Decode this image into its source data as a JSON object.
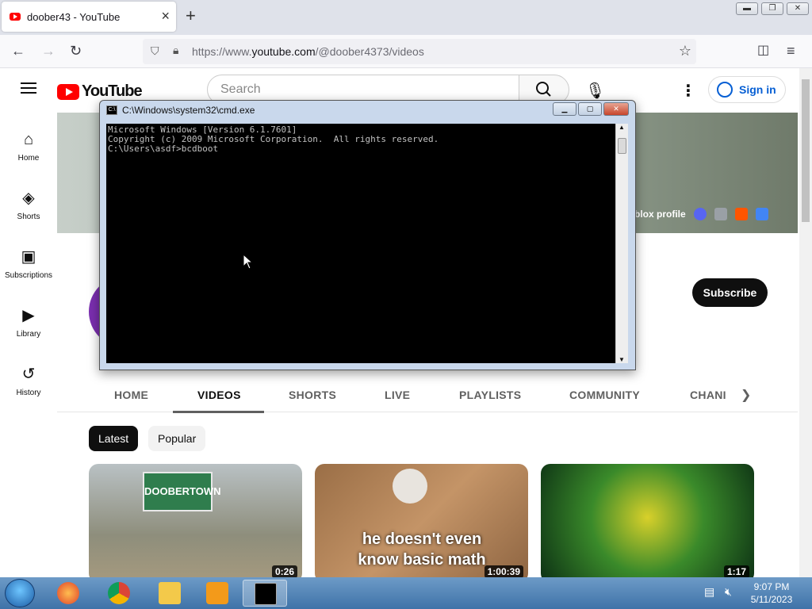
{
  "browser": {
    "tab_title": "doober43 - YouTube",
    "url_prefix": "https://www.",
    "url_domain": "youtube.com",
    "url_path": "/@doober4373/videos"
  },
  "youtube": {
    "logo_text": "YouTube",
    "search_placeholder": "Search",
    "signin_label": "Sign in",
    "sidebar": [
      {
        "label": "Home",
        "icon": "home-icon"
      },
      {
        "label": "Shorts",
        "icon": "shorts-icon"
      },
      {
        "label": "Subscriptions",
        "icon": "subscriptions-icon"
      },
      {
        "label": "Library",
        "icon": "library-icon"
      },
      {
        "label": "History",
        "icon": "history-icon"
      }
    ],
    "banner_link_text": "blox profile",
    "subscribe_label": "Subscribe",
    "channel_tabs": [
      "HOME",
      "VIDEOS",
      "SHORTS",
      "LIVE",
      "PLAYLISTS",
      "COMMUNITY",
      "CHANI"
    ],
    "active_tab": "VIDEOS",
    "chips": [
      "Latest",
      "Popular"
    ],
    "videos": [
      {
        "overlay": "DOOBERTOWN",
        "duration": "0:26"
      },
      {
        "overlay": "he doesn't even know basic math",
        "duration": "1:00:39"
      },
      {
        "overlay": "",
        "duration": "1:17"
      }
    ]
  },
  "cmd": {
    "title": "C:\\Windows\\system32\\cmd.exe",
    "lines": [
      "Microsoft Windows [Version 6.1.7601]",
      "Copyright (c) 2009 Microsoft Corporation.  All rights reserved.",
      "",
      "C:\\Users\\asdf>bcdboot"
    ]
  },
  "taskbar": {
    "time": "9:07 PM",
    "date": "5/11/2023"
  },
  "colors": {
    "youtube_red": "#ff0000",
    "signin_blue": "#065fd4",
    "avatar_purple": "#7b2fb0"
  }
}
